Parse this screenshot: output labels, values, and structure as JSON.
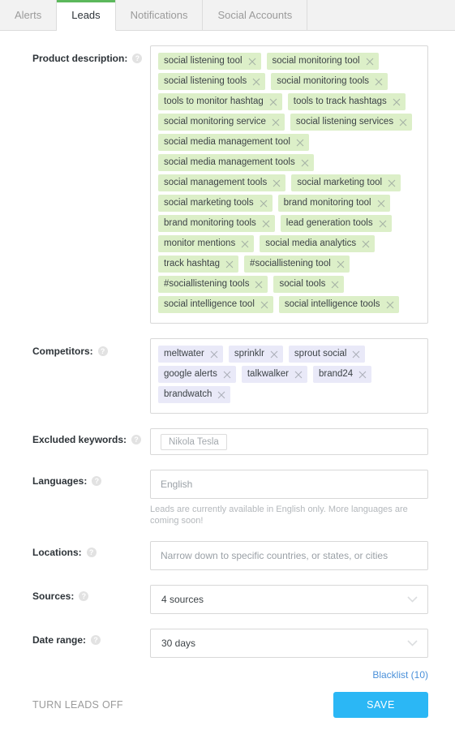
{
  "tabs": [
    {
      "label": "Alerts",
      "active": false
    },
    {
      "label": "Leads",
      "active": true
    },
    {
      "label": "Notifications",
      "active": false
    },
    {
      "label": "Social Accounts",
      "active": false
    }
  ],
  "help_icon_glyph": "?",
  "fields": {
    "product_description": {
      "label": "Product description:",
      "tags": [
        "social listening tool",
        "social monitoring tool",
        "social listening tools",
        "social monitoring tools",
        "tools to monitor hashtag",
        "tools to track hashtags",
        "social monitoring service",
        "social listening services",
        "social media management tool",
        "social media management tools",
        "social management tools",
        "social marketing tool",
        "social marketing tools",
        "brand monitoring tool",
        "brand monitoring tools",
        "lead generation tools",
        "monitor mentions",
        "social media analytics",
        "track hashtag",
        "#sociallistening tool",
        "#sociallistening tools",
        "social tools",
        "social intelligence tool",
        "social intelligence tools"
      ]
    },
    "competitors": {
      "label": "Competitors:",
      "tags": [
        "meltwater",
        "sprinklr",
        "sprout social",
        "google alerts",
        "talkwalker",
        "brand24",
        "brandwatch"
      ]
    },
    "excluded_keywords": {
      "label": "Excluded keywords:",
      "placeholder_chip": "Nikola Tesla"
    },
    "languages": {
      "label": "Languages:",
      "placeholder": "English",
      "hint": "Leads are currently available in English only. More languages are coming soon!"
    },
    "locations": {
      "label": "Locations:",
      "placeholder": "Narrow down to specific countries, or states, or cities"
    },
    "sources": {
      "label": "Sources:",
      "value": "4 sources"
    },
    "date_range": {
      "label": "Date range:",
      "value": "30 days"
    }
  },
  "footer": {
    "blacklist_label": "Blacklist (10)",
    "turn_off_label": "TURN LEADS OFF",
    "save_label": "SAVE"
  },
  "colors": {
    "accent_green": "#5cb85c",
    "tag_green": "#dcefc8",
    "tag_violet": "#e9e9f8",
    "save_blue": "#2bb7f5",
    "link_blue": "#4a90d9"
  }
}
